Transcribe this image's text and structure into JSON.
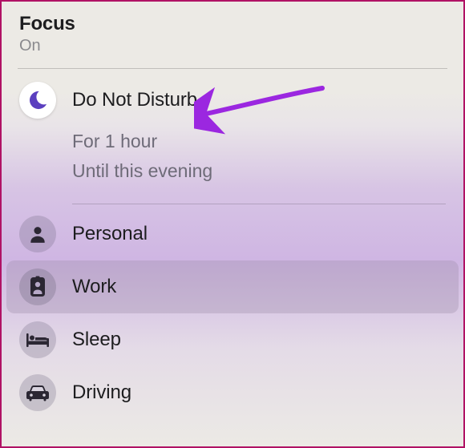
{
  "header": {
    "title": "Focus",
    "status": "On"
  },
  "modes": {
    "dnd": {
      "label": "Do Not Disturb"
    },
    "personal": {
      "label": "Personal"
    },
    "work": {
      "label": "Work"
    },
    "sleep": {
      "label": "Sleep"
    },
    "driving": {
      "label": "Driving"
    }
  },
  "dnd_options": {
    "for_1_hour": "For 1 hour",
    "until_evening": "Until this evening"
  },
  "colors": {
    "annotation": "#9b27e0",
    "moon": "#5b3fbf",
    "icon_inactive": "#2b2733"
  }
}
